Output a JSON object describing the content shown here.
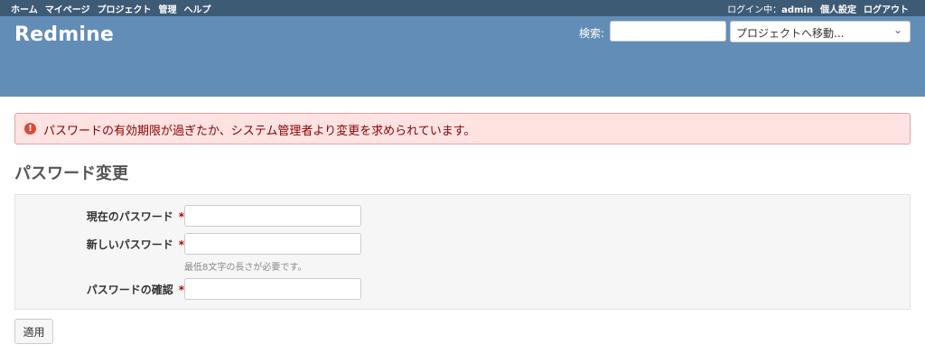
{
  "top_menu": {
    "items": [
      "ホーム",
      "マイページ",
      "プロジェクト",
      "管理",
      "ヘルプ"
    ],
    "logged_as_prefix": "ログイン中：",
    "user": "admin",
    "my_account": "個人設定",
    "logout": "ログアウト"
  },
  "header": {
    "title": "Redmine",
    "search_label": "検索:",
    "search_value": "",
    "jump_placeholder": "プロジェクトへ移動..."
  },
  "flash": {
    "icon": "error-icon",
    "message": "パスワードの有効期限が過ぎたか、システム管理者より変更を求められています。"
  },
  "page_title": "パスワード変更",
  "form": {
    "current_password_label": "現在のパスワード",
    "new_password_label": "新しいパスワード",
    "new_password_hint": "最低8文字の長さが必要です。",
    "confirm_password_label": "パスワードの確認",
    "required_mark": "*",
    "submit_label": "適用"
  },
  "colors": {
    "top_menu_bg": "#3e5b76",
    "header_bg": "#628db6",
    "flash_bg": "#ffe3e3",
    "flash_text": "#880000",
    "required": "#bb0000"
  }
}
